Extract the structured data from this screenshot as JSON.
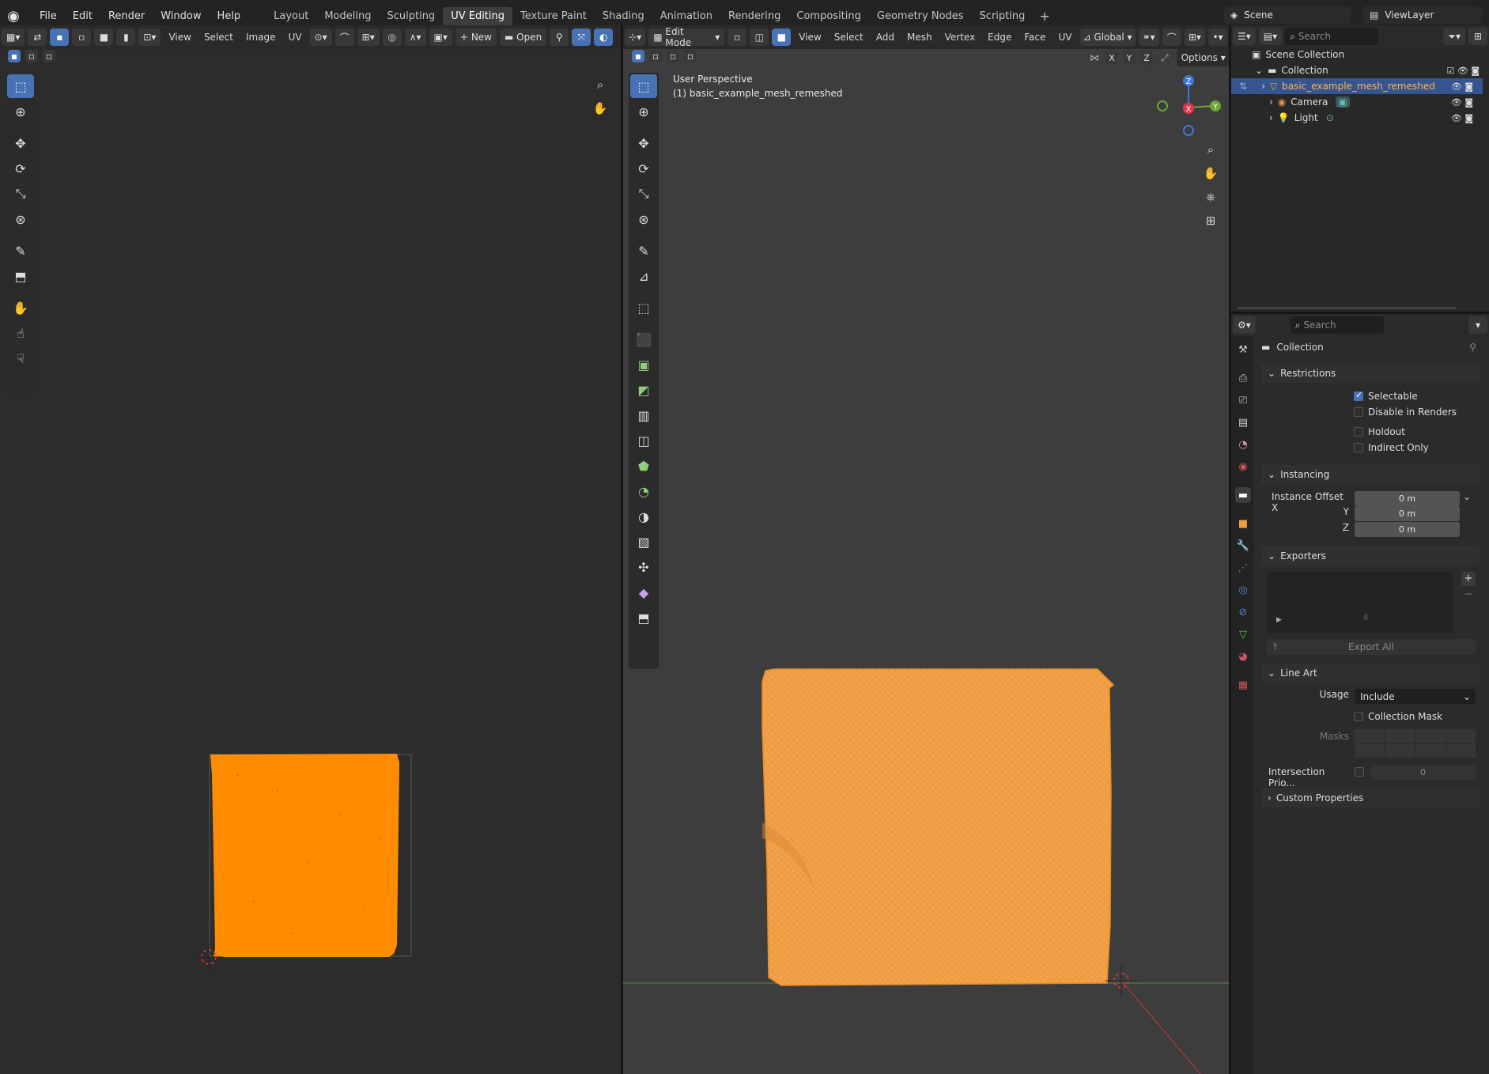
{
  "app": {
    "menus": [
      "File",
      "Edit",
      "Render",
      "Window",
      "Help"
    ],
    "workspaces": [
      "Layout",
      "Modeling",
      "Sculpting",
      "UV Editing",
      "Texture Paint",
      "Shading",
      "Animation",
      "Rendering",
      "Compositing",
      "Geometry Nodes",
      "Scripting"
    ],
    "active_workspace": "UV Editing",
    "add_workspace": "+",
    "scene": "Scene",
    "view_layer": "ViewLayer"
  },
  "uv_editor": {
    "menus": [
      "View",
      "Select",
      "Image",
      "UV"
    ],
    "new_label": "New",
    "open_label": "Open",
    "island_color": "#ff8c00"
  },
  "viewport": {
    "mode": "Edit Mode",
    "menus": [
      "View",
      "Select",
      "Add",
      "Mesh",
      "Vertex",
      "Edge",
      "Face",
      "UV"
    ],
    "transform": "Global",
    "axes": [
      "X",
      "Y",
      "Z"
    ],
    "options_label": "Options",
    "overlay_title": "User Perspective",
    "overlay_object": "(1) basic_example_mesh_remeshed",
    "gizmo": {
      "x": "X",
      "y": "Y",
      "z": "Z"
    },
    "mesh_color": "#f2a24a"
  },
  "outliner": {
    "search_placeholder": "Search",
    "root": "Scene Collection",
    "collection": "Collection",
    "items": [
      {
        "name": "basic_example_mesh_remeshed",
        "selected": true
      },
      {
        "name": "Camera",
        "selected": false
      },
      {
        "name": "Light",
        "selected": false
      }
    ]
  },
  "properties": {
    "search_placeholder": "Search",
    "title": "Collection",
    "restrictions": {
      "heading": "Restrictions",
      "selectable": "Selectable",
      "disable_renders": "Disable in Renders",
      "holdout": "Holdout",
      "indirect_only": "Indirect Only"
    },
    "instancing": {
      "heading": "Instancing",
      "offset_x_label": "Instance Offset X",
      "y_label": "Y",
      "z_label": "Z",
      "x": "0 m",
      "y": "0 m",
      "z": "0 m"
    },
    "exporters": {
      "heading": "Exporters",
      "export_all": "Export All"
    },
    "line_art": {
      "heading": "Line Art",
      "usage_label": "Usage",
      "usage_value": "Include",
      "collection_mask": "Collection Mask",
      "masks_label": "Masks",
      "intersection_label": "Intersection Prio...",
      "intersection_value": "0"
    },
    "custom_properties": "Custom Properties"
  }
}
